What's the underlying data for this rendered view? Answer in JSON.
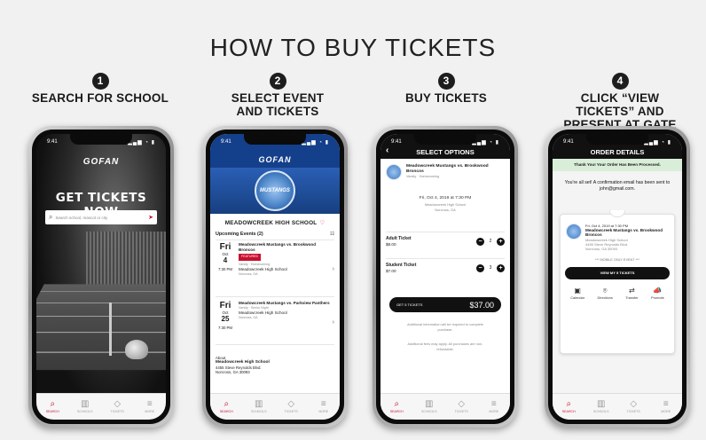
{
  "title": "HOW TO BUY TICKETS",
  "steps": [
    {
      "num": "1",
      "label": "SEARCH FOR SCHOOL"
    },
    {
      "num": "2",
      "label": "SELECT EVENT AND TICKETS"
    },
    {
      "num": "3",
      "label": "BUY TICKETS"
    },
    {
      "num": "4",
      "label": "CLICK “VIEW TICKETS” AND PRESENT AT GATE"
    }
  ],
  "status_time": "9:41",
  "app_logo": "GOFAN",
  "tabbar": [
    "SEARCH",
    "SCHOOLS",
    "TICKETS",
    "MORE"
  ],
  "screen1": {
    "headline": "GET TICKETS NOW",
    "search_placeholder": "Search school, mascot or city"
  },
  "screen2": {
    "badge_text": "MUSTANGS",
    "school": "MEADOWCREEK HIGH SCHOOL",
    "upcoming": "Upcoming Events (2)",
    "events": [
      {
        "dow": "Fri",
        "mon": "Oct",
        "day": "4",
        "time": "7:30 PM",
        "name": "Meadowcreek Mustangs vs. Brookwood Broncos",
        "tag": "FEATURED",
        "sub": "Varsity · Homecoming",
        "venue": "Meadowcreek High School",
        "city": "Norcross, GA"
      },
      {
        "dow": "Fri",
        "mon": "Oct",
        "day": "25",
        "time": "7:30 PM",
        "name": "Meadowcreek Mustangs vs. Parkview Panthers",
        "sub": "Varsity · Senior Night",
        "venue": "Meadowcreek High School",
        "city": "Norcross, GA"
      }
    ],
    "about_label": "About",
    "about_name": "Meadowcreek High School",
    "about_addr1": "4455 Steve Reynolds Blvd.",
    "about_addr2": "Norcross, GA 30093"
  },
  "screen3": {
    "header": "SELECT OPTIONS",
    "event_name": "Meadowcreek Mustangs vs. Brookwood Broncos",
    "event_sub": "Varsity · Homecoming",
    "event_date": "Fri, Oct 4, 2019 at 7:30 PM",
    "venue": "Meadowcreek High School",
    "city": "Norcross, GA",
    "tickets": [
      {
        "name": "Adult Ticket",
        "price": "$8.00",
        "qty": "2"
      },
      {
        "name": "Student Ticket",
        "price": "$7.00",
        "qty": "3"
      }
    ],
    "button_label": "GET 5 TICKETS",
    "total": "$37.00",
    "note1": "Additional information will be required to complete purchase.",
    "note2": "Additional fees may apply. All purchases are non-refundable."
  },
  "screen4": {
    "header": "ORDER DETAILS",
    "confirm": "Thank You! Your Order Has Been Processed.",
    "all_set": "You're all set! A confirmation email has been sent to john@gmail.com.",
    "event_date": "Fri, Oct 4, 2019 at 7:30 PM",
    "event_name": "Meadowcreek Mustangs vs. Brookwood Broncos",
    "venue": "Meadowcreek High School",
    "addr": "4455 Steve Reynolds Blvd.",
    "city": "Norcross, GA 30093",
    "mobile": "*** MOBILE ONLY EVENT ***",
    "view_button": "VIEW MY 5 TICKETS",
    "actions": [
      "Calendar",
      "Directions",
      "Transfer",
      "Promote"
    ]
  }
}
